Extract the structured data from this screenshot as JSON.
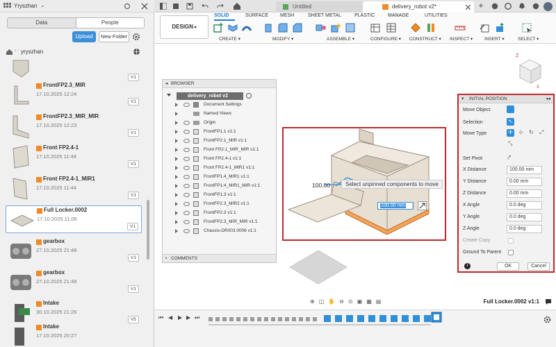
{
  "left_panel": {
    "user": "Yryszhan",
    "tabs": [
      "Data",
      "People"
    ],
    "upload_label": "Upload",
    "new_folder_label": "New Folder",
    "breadcrumb": "yryszhan",
    "items": [
      {
        "name": "",
        "date": "",
        "version": "V1"
      },
      {
        "name": "FrontFP2.3_MIR",
        "date": "17.10.2025 12:24",
        "version": "V1"
      },
      {
        "name": "FrontFP2.3_MIR_MIR",
        "date": "17.10.2025 12:23",
        "version": "V1"
      },
      {
        "name": "Front FP2.4-1",
        "date": "17.10.2025 11:44",
        "version": "V1"
      },
      {
        "name": "Front FP2.4-1_MIR1",
        "date": "17.10.2025 11:44",
        "version": "V1"
      },
      {
        "name": "Full Locker.0002",
        "date": "17.10.2025 11:05",
        "version": "V1"
      },
      {
        "name": "gearbox",
        "date": "27.10.2025 21:48",
        "version": "V1"
      },
      {
        "name": "gearbox",
        "date": "27.10.2025 21:48",
        "version": "V1"
      },
      {
        "name": "Intake",
        "date": "30.10.2025 21:26",
        "version": "V5"
      },
      {
        "name": "Intake",
        "date": "17.10.2025 20:27",
        "version": ""
      }
    ]
  },
  "tabs": {
    "untitled": "Untitled",
    "active": "delivery_robot v2*"
  },
  "ribbon": {
    "workspace": "DESIGN",
    "tabs": [
      "SOLID",
      "SURFACE",
      "MESH",
      "SHEET METAL",
      "PLASTIC",
      "MANAGE",
      "UTILITIES"
    ],
    "groups": [
      "CREATE",
      "MODIFY",
      "ASSEMBLE",
      "CONFIGURE",
      "CONSTRUCT",
      "INSPECT",
      "INSERT",
      "SELECT"
    ]
  },
  "browser": {
    "title": "BROWSER",
    "root": "delivery_robot v2",
    "rows": [
      "Document Settings",
      "Named Views",
      "Origin",
      "FrontFP1.1 v1:1",
      "FrontFP2.1_MIR v1:1",
      "Front FP2.1_MIR_MIR v1:1",
      "Front FP2.4-1 v1:1",
      "Front FP2.4-1_MIR1 v1:1",
      "FrontFP1.4_MIR1 v1:1",
      "FrontFP1.4_MIR1_MIR v1:1",
      "FrontFP1.3 v1:1",
      "FrontFP2.3_MIR2 v1:1",
      "FrontFP2.3 v1:1",
      "FrontFP2.3_MIR_MIR v1:1",
      "Chassis-DR003.0006 v1:1"
    ],
    "comments": "COMMENTS"
  },
  "viewport": {
    "tooltip": "Select unpinned components to move",
    "distance_label": "100.00",
    "distance_input": "100.00 mm"
  },
  "initial_position": {
    "title": "INITIAL POSITION",
    "move_object": "Move Object",
    "selection": "Selection",
    "move_type": "Move Type",
    "set_pivot": "Set Pivot",
    "fields": [
      {
        "label": "X Distance",
        "value": "100.00 mm"
      },
      {
        "label": "Y Distance",
        "value": "0.00 mm"
      },
      {
        "label": "Z Distance",
        "value": "0.00 mm"
      },
      {
        "label": "X Angle",
        "value": "0.0 deg"
      },
      {
        "label": "Y Angle",
        "value": "0.0 deg"
      },
      {
        "label": "Z Angle",
        "value": "0.0 deg"
      }
    ],
    "create_copy": "Create Copy",
    "ground_to_parent": "Ground To Parent",
    "ok": "OK",
    "cancel": "Cancel"
  },
  "status": {
    "selected_name": "Full Locker.0002 v1:1"
  }
}
